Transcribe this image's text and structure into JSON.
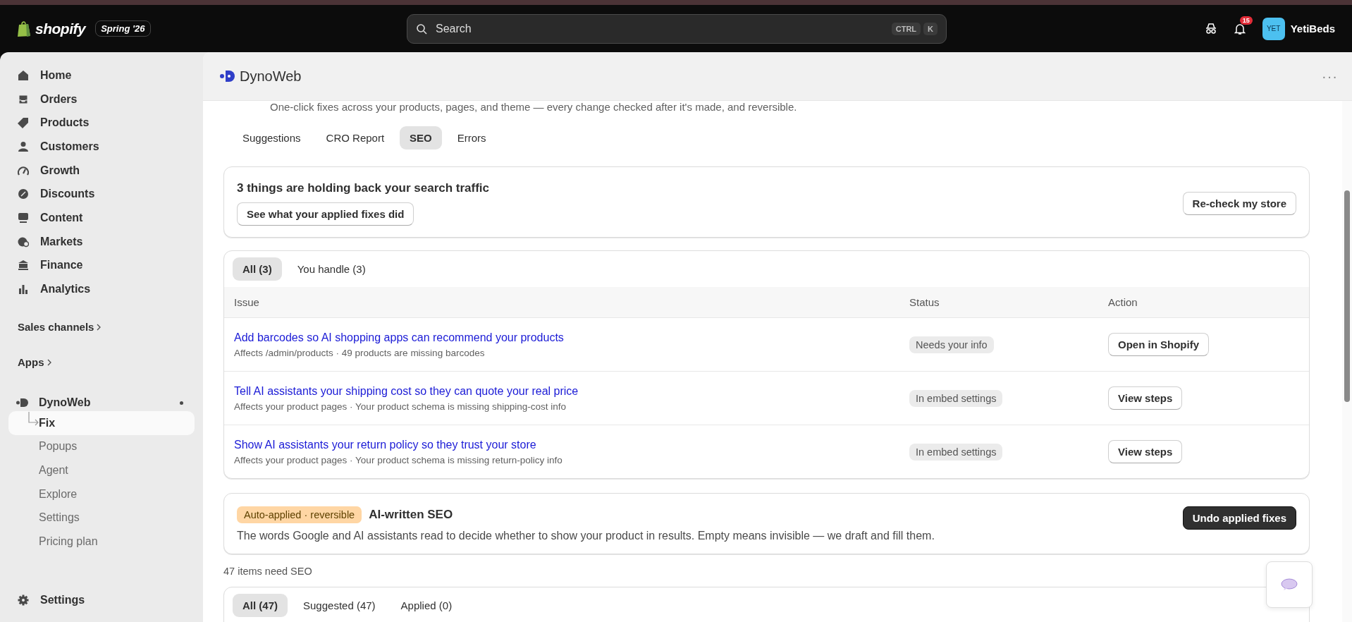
{
  "topbar": {
    "logo": "shopify",
    "edition": "Spring '26",
    "search": {
      "placeholder": "Search",
      "keys": [
        "CTRL",
        "K"
      ]
    },
    "notifications": "15",
    "avatar": "YET",
    "store": "YetiBeds"
  },
  "sidebar": {
    "items": [
      {
        "label": "Home",
        "selected": false
      },
      {
        "label": "Orders",
        "selected": false
      },
      {
        "label": "Products",
        "selected": false
      },
      {
        "label": "Customers",
        "selected": false
      },
      {
        "label": "Growth",
        "selected": false
      },
      {
        "label": "Discounts",
        "selected": false
      },
      {
        "label": "Content",
        "selected": false
      },
      {
        "label": "Markets",
        "selected": false
      },
      {
        "label": "Finance",
        "selected": false
      },
      {
        "label": "Analytics",
        "selected": false
      }
    ],
    "sections": [
      "Sales channels",
      "Apps"
    ],
    "app": {
      "name": "DynoWeb",
      "pinned": true,
      "children": [
        {
          "label": "Fix",
          "selected": true
        },
        {
          "label": "Popups",
          "selected": false
        },
        {
          "label": "Agent",
          "selected": false
        },
        {
          "label": "Explore",
          "selected": false
        },
        {
          "label": "Settings",
          "selected": false
        },
        {
          "label": "Pricing plan",
          "selected": false
        }
      ]
    },
    "settings": "Settings"
  },
  "app_header": {
    "title": "DynoWeb",
    "menu": "···"
  },
  "subtitle": "One-click fixes across your products, pages, and theme — every change checked after it's made, and reversible.",
  "tabs": [
    {
      "label": "Suggestions",
      "selected": false
    },
    {
      "label": "CRO Report",
      "selected": false
    },
    {
      "label": "SEO",
      "selected": true
    },
    {
      "label": "Errors",
      "selected": false
    }
  ],
  "summary": {
    "title": "3 things are holding back your search traffic",
    "button": "See what your applied fixes did",
    "action": "Re-check my store"
  },
  "issues": {
    "filters": [
      {
        "label": "All (3)",
        "selected": true
      },
      {
        "label": "You handle (3)",
        "selected": false
      }
    ],
    "columns": [
      "Issue",
      "Status",
      "Action"
    ],
    "rows": [
      {
        "title": "Add barcodes so AI shopping apps can recommend your products",
        "detail": "Affects /admin/products · 49 products are missing barcodes",
        "status": "Needs your info",
        "action": "Open in Shopify"
      },
      {
        "title": "Tell AI assistants your shipping cost so they can quote your real price",
        "detail": "Affects your product pages · Your product schema is missing shipping-cost info",
        "status": "In embed settings",
        "action": "View steps"
      },
      {
        "title": "Show AI assistants your return policy so they trust your store",
        "detail": "Affects your product pages · Your product schema is missing return-policy info",
        "status": "In embed settings",
        "action": "View steps"
      }
    ]
  },
  "auto_card": {
    "badge": "Auto-applied · reversible",
    "title": "AI-written SEO",
    "text": "The words Google and AI assistants read to decide whether to show your product in results. Empty means invisible — we draft and fill them.",
    "button": "Undo applied fixes"
  },
  "items_count": "47 items need SEO",
  "items_filters": [
    {
      "label": "All (47)",
      "selected": true
    },
    {
      "label": "Suggested (47)",
      "selected": false
    },
    {
      "label": "Applied (0)",
      "selected": false
    }
  ]
}
